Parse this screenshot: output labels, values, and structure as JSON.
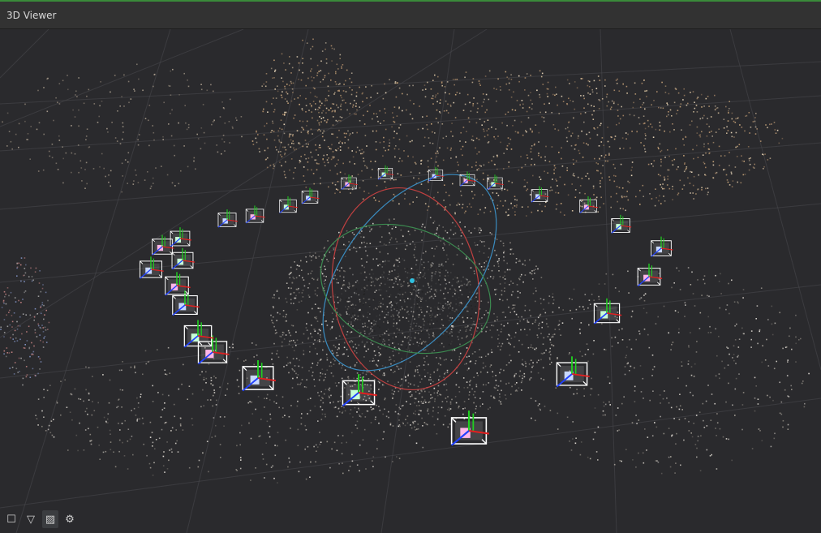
{
  "window": {
    "title": "3D Viewer"
  },
  "toolbar": {
    "buttons": [
      {
        "icon": "square-icon",
        "glyph": "☐",
        "active": false
      },
      {
        "icon": "triangle-down-icon",
        "glyph": "▽",
        "active": false
      },
      {
        "icon": "grid-hatch-icon",
        "glyph": "▨",
        "active": true
      },
      {
        "icon": "gear-icon",
        "glyph": "⚙",
        "active": false
      }
    ]
  },
  "colors": {
    "background": "#2a2a2d",
    "grid": "#4a4a4f",
    "camera_frame": "#ffffff",
    "axis_x": "#e02020",
    "axis_y": "#20d020",
    "axis_z": "#2040ff",
    "gizmo_red": "#c04040",
    "gizmo_green": "#3c8a50",
    "gizmo_blue": "#3a8cc0",
    "pivot": "#30c0e0"
  }
}
